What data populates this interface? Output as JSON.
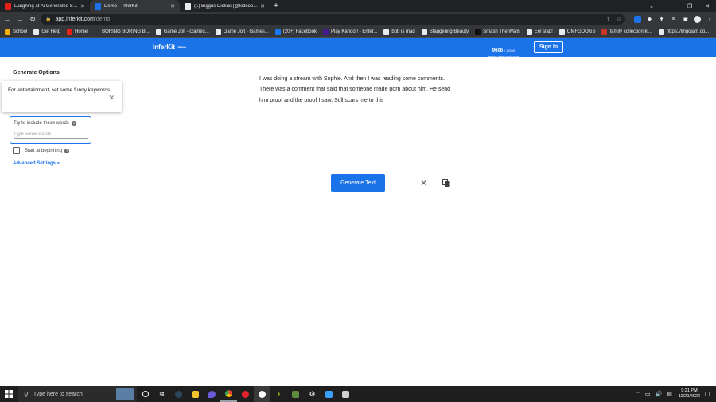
{
  "browser": {
    "tabs": [
      {
        "title": "Laughing at Ai Generated Storie",
        "active": false,
        "favicon_color": "#e62117"
      },
      {
        "title": "Demo – InferKit",
        "active": true,
        "favicon_color": "#1a73e8"
      },
      {
        "title": "(1) Biggus Dickus (@kidsophie) · ",
        "active": false,
        "favicon_color": "#e8eaed"
      }
    ],
    "new_tab": "+",
    "url_host": "app.inferkit.com",
    "url_path": "/demo"
  },
  "bookmarks": [
    {
      "label": "School",
      "color": "#f9ab00"
    },
    {
      "label": "Get Help",
      "color": "#e8eaed"
    },
    {
      "label": "Home",
      "color": "#e62117"
    },
    {
      "label": "BORING BORING B...",
      "color": "#35363a"
    },
    {
      "label": "Game Jolt - Games...",
      "color": "#e8eaed"
    },
    {
      "label": "Game Jolt - Games...",
      "color": "#e8eaed"
    },
    {
      "label": "(20+) Facebook",
      "color": "#1877f2"
    },
    {
      "label": "Play Kahoot! - Enter...",
      "color": "#46178f"
    },
    {
      "label": "bob is mad",
      "color": "#e8eaed"
    },
    {
      "label": "Staggering Beauty",
      "color": "#e8eaed"
    },
    {
      "label": "Smash The Walls",
      "color": "#111111"
    },
    {
      "label": "Eel slap!",
      "color": "#e8eaed"
    },
    {
      "label": "OMFGDOGS",
      "color": "#e8eaed"
    },
    {
      "label": "family collection ki...",
      "color": "#c0392b"
    },
    {
      "label": "https://lingojam.co...",
      "color": "#e8eaed"
    }
  ],
  "app": {
    "brand": "InferKit",
    "brand_badge": "DEMO",
    "credits_value": "9606",
    "credits_total": "/ 10000",
    "credits_label": "weekly free characters",
    "signin_label": "Sign In"
  },
  "options": {
    "title": "Generate Options",
    "tooltip_text": "For entertainment, set some funny keywords..",
    "keywords_label": "Try to include these words",
    "keywords_placeholder": "Type some words",
    "keywords_value": "",
    "start_label": "Start at beginning",
    "start_checked": false,
    "advanced_label": "Advanced Settings »"
  },
  "editor": {
    "text": "I was doing a stream with Sophie. And then I was reading some comments. There was a comment that said that someone made porn about him. He send him proof and the proof I saw. Still scars me to this",
    "generate_label": "Generate Text"
  },
  "taskbar": {
    "search_placeholder": "Type here to search",
    "time": "9:21 PM",
    "date": "11/20/2022"
  }
}
